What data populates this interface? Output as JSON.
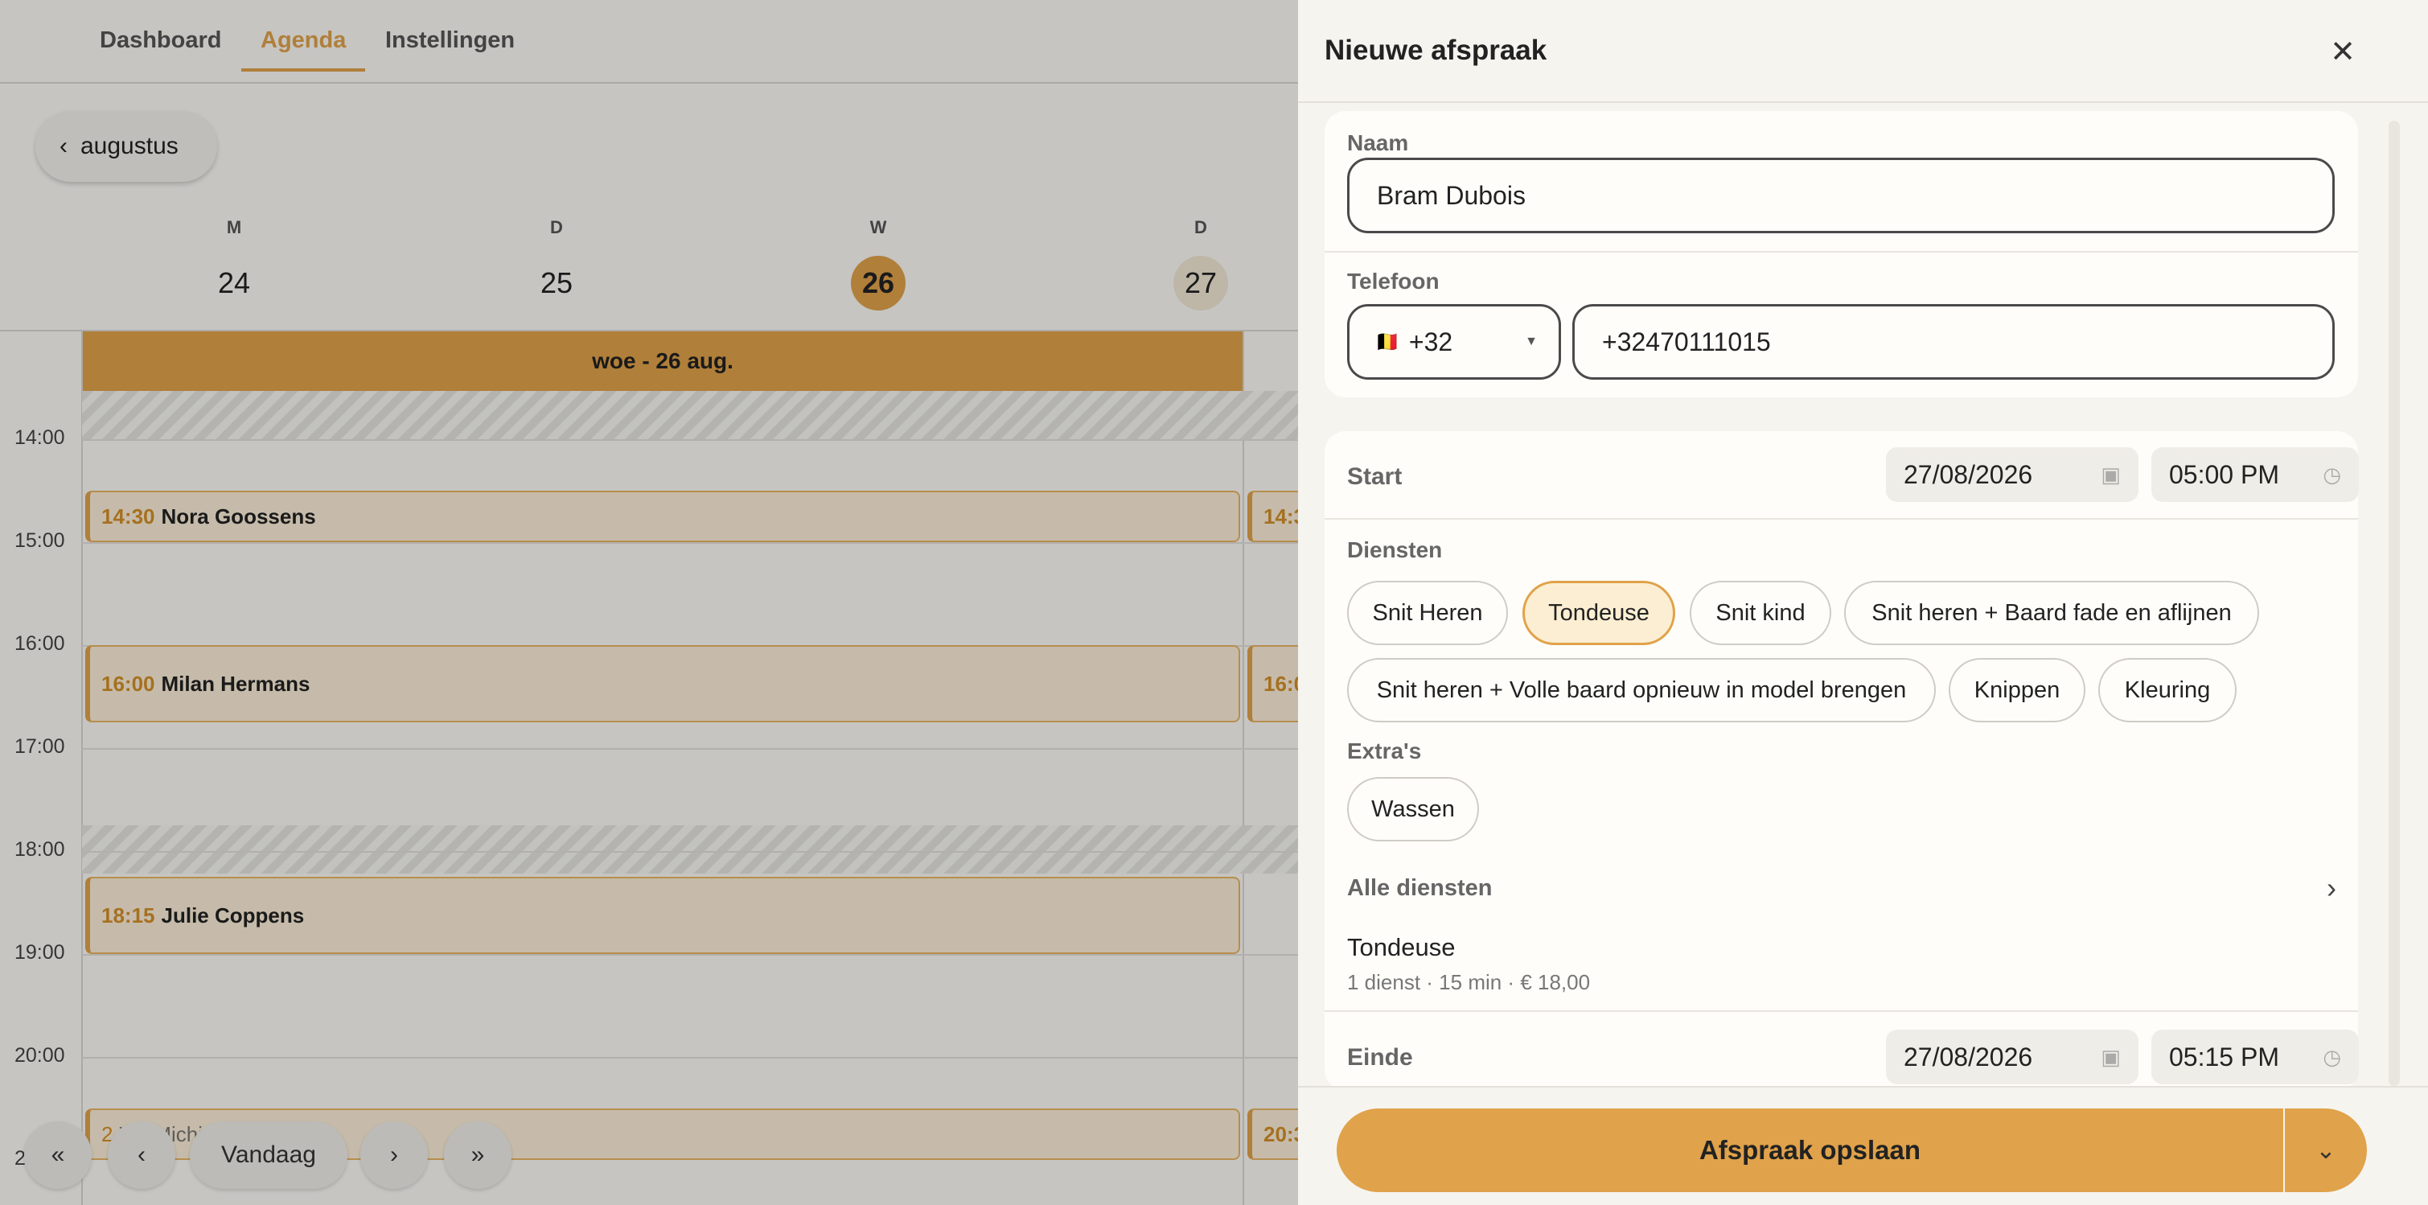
{
  "nav": {
    "tabs": [
      {
        "label": "Dashboard"
      },
      {
        "label": "Agenda"
      },
      {
        "label": "Instellingen"
      }
    ]
  },
  "calendar": {
    "month_button": "augustus",
    "days": [
      {
        "letter": "M",
        "num": "24"
      },
      {
        "letter": "D",
        "num": "25"
      },
      {
        "letter": "W",
        "num": "26"
      },
      {
        "letter": "D",
        "num": "27"
      }
    ],
    "day_header": "woe - 26 aug.",
    "hours": [
      "14:00",
      "15:00",
      "16:00",
      "17:00",
      "18:00",
      "19:00",
      "20:00",
      "2"
    ],
    "events": [
      {
        "time": "14:30",
        "name": "Nora Goossens"
      },
      {
        "time": "16:00",
        "name": "Milan Hermans"
      },
      {
        "time": "18:15",
        "name": "Julie Coppens"
      },
      {
        "time": "2",
        "name": "Vic Michiels"
      }
    ],
    "side_events": [
      "14:3",
      "16:0",
      "20:3"
    ],
    "pager": {
      "today": "Vandaag"
    }
  },
  "panel": {
    "title": "Nieuwe afspraak",
    "name_label": "Naam",
    "name_value": "Bram Dubois",
    "phone_label": "Telefoon",
    "phone_prefix": "+32",
    "phone_flag": "🇧🇪",
    "phone_value": "+32470111015",
    "start_label": "Start",
    "start_date": "27/08/2026",
    "start_time": "05:00 PM",
    "services_label": "Diensten",
    "services": [
      {
        "label": "Snit Heren",
        "selected": false
      },
      {
        "label": "Tondeuse",
        "selected": true
      },
      {
        "label": "Snit kind",
        "selected": false
      },
      {
        "label": "Snit heren + Baard fade en aflijnen",
        "selected": false
      },
      {
        "label": "Snit heren + Volle baard opnieuw in model brengen",
        "selected": false
      },
      {
        "label": "Knippen",
        "selected": false
      },
      {
        "label": "Kleuring",
        "selected": false
      }
    ],
    "extras_label": "Extra's",
    "extras": [
      {
        "label": "Wassen"
      }
    ],
    "all_services_label": "Alle diensten",
    "summary_title": "Tondeuse",
    "summary_detail": "1 dienst · 15 min · € 18,00",
    "end_label": "Einde",
    "end_date": "27/08/2026",
    "end_time": "05:15 PM",
    "save_label": "Afspraak opslaan"
  },
  "colors": {
    "accent": "#e0a24a",
    "event_bg": "#fbeed8",
    "panel_bg": "#f6f4ef"
  }
}
